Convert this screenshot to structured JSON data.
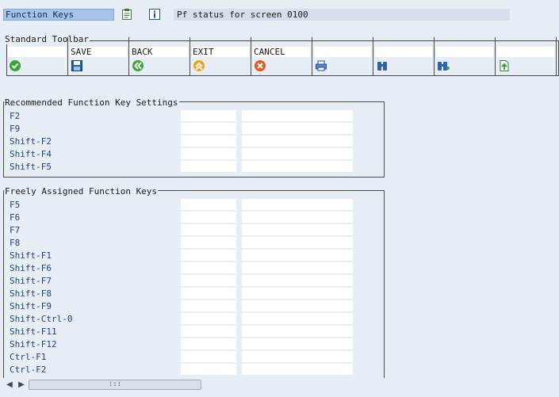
{
  "header": {
    "object_type": "Function Keys",
    "description": "Pf status for screen 0100",
    "icons": [
      "menu-painter-icon",
      "info-icon"
    ]
  },
  "toolbar": {
    "title": "Standard Toolbar",
    "cells": [
      {
        "label": "",
        "icon": "check-icon"
      },
      {
        "label": "SAVE",
        "icon": "save-icon"
      },
      {
        "label": "BACK",
        "icon": "back-icon"
      },
      {
        "label": "EXIT",
        "icon": "exit-icon"
      },
      {
        "label": "CANCEL",
        "icon": "cancel-icon"
      },
      {
        "label": "",
        "icon": "print-icon"
      },
      {
        "label": "",
        "icon": "find-icon"
      },
      {
        "label": "",
        "icon": "find-next-icon"
      },
      {
        "label": "",
        "icon": "page-up-icon"
      }
    ]
  },
  "recommended": {
    "title": "Recommended Function Key Settings",
    "keys": [
      "F2",
      "F9",
      "Shift-F2",
      "Shift-F4",
      "Shift-F5"
    ]
  },
  "freely": {
    "title": "Freely Assigned Function Keys",
    "keys": [
      "F5",
      "F6",
      "F7",
      "F8",
      "Shift-F1",
      "Shift-F6",
      "Shift-F7",
      "Shift-F8",
      "Shift-F9",
      "Shift-Ctrl-0",
      "Shift-F11",
      "Shift-F12",
      "Ctrl-F1",
      "Ctrl-F2"
    ]
  },
  "scrollbar": {
    "thumb_grip": ":::"
  },
  "colors": {
    "background": "#e8eef5",
    "field_highlight": "#a9c2e8",
    "key_text": "#1f3f8a"
  }
}
